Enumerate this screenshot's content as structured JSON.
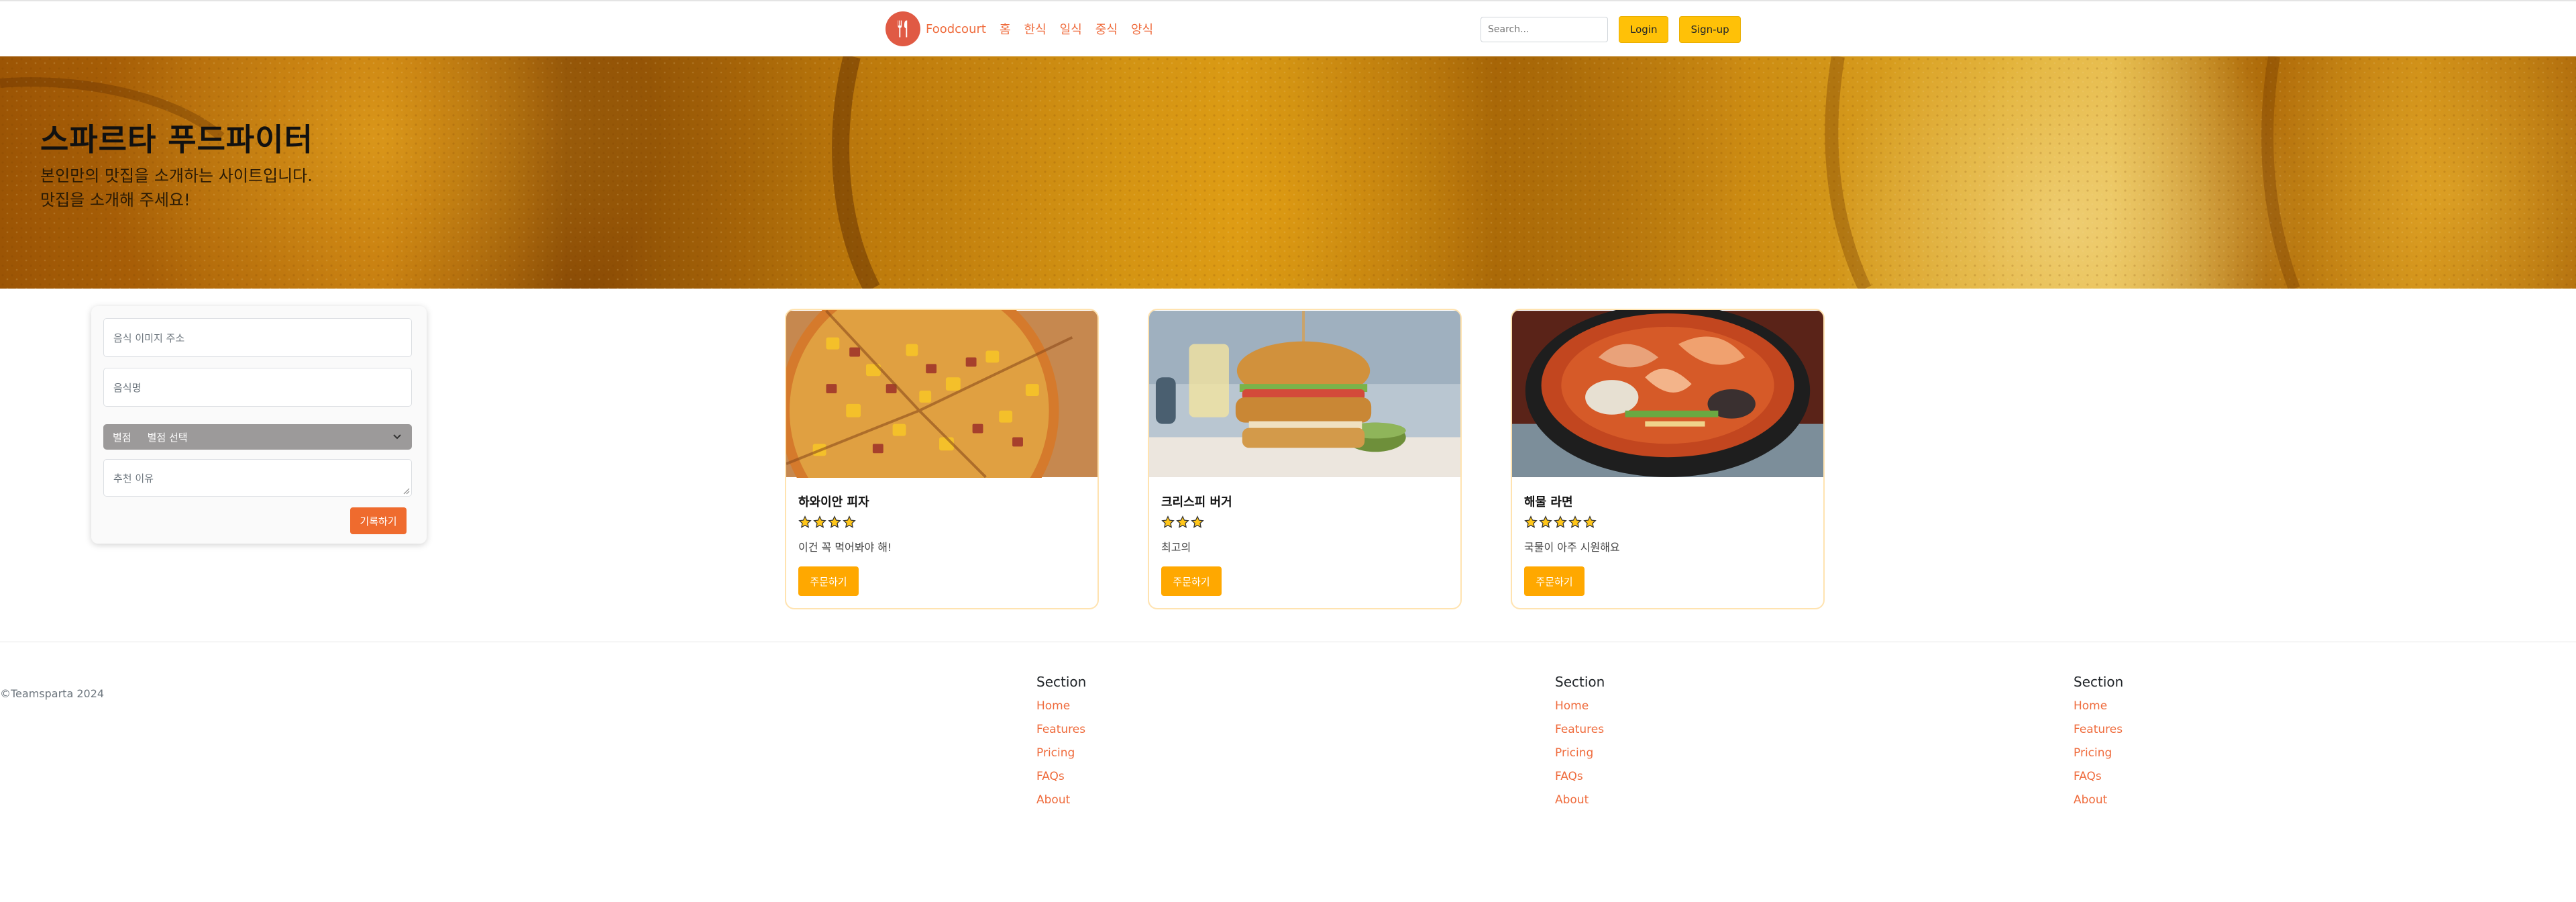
{
  "navbar": {
    "brand": "Foodcourt",
    "links": [
      "홈",
      "한식",
      "일식",
      "중식",
      "양식"
    ],
    "search_placeholder": "Search...",
    "login_label": "Login",
    "signup_label": "Sign-up"
  },
  "hero": {
    "title": "스파르타 푸드파이터",
    "subtitle_line1": "본인만의 맛집을 소개하는 사이트입니다.",
    "subtitle_line2": "맛집을 소개해 주세요!"
  },
  "form": {
    "image_placeholder": "음식 이미지 주소",
    "name_placeholder": "음식명",
    "rating_label": "별점",
    "rating_value": "별점 선택",
    "reason_placeholder": "추천 이유",
    "submit_label": "기록하기"
  },
  "cards": [
    {
      "title": "하와이안 피자",
      "rating": 4,
      "comment": "이건 꼭 먹어봐야 해!",
      "button": "주문하기"
    },
    {
      "title": "크리스피 버거",
      "rating": 3,
      "comment": "최고의",
      "button": "주문하기"
    },
    {
      "title": "해물 라면",
      "rating": 5,
      "comment": "국물이 아주 시원해요",
      "button": "주문하기"
    }
  ],
  "footer": {
    "copyright": "©Teamsparta 2024",
    "sections": [
      {
        "heading": "Section",
        "links": [
          "Home",
          "Features",
          "Pricing",
          "FAQs",
          "About"
        ]
      },
      {
        "heading": "Section",
        "links": [
          "Home",
          "Features",
          "Pricing",
          "FAQs",
          "About"
        ]
      },
      {
        "heading": "Section",
        "links": [
          "Home",
          "Features",
          "Pricing",
          "FAQs",
          "About"
        ]
      }
    ]
  },
  "colors": {
    "accent": "#ef6b3c",
    "button_yellow": "#ffc107",
    "order_button": "#ffa800",
    "card_border": "#ffe3b0"
  }
}
